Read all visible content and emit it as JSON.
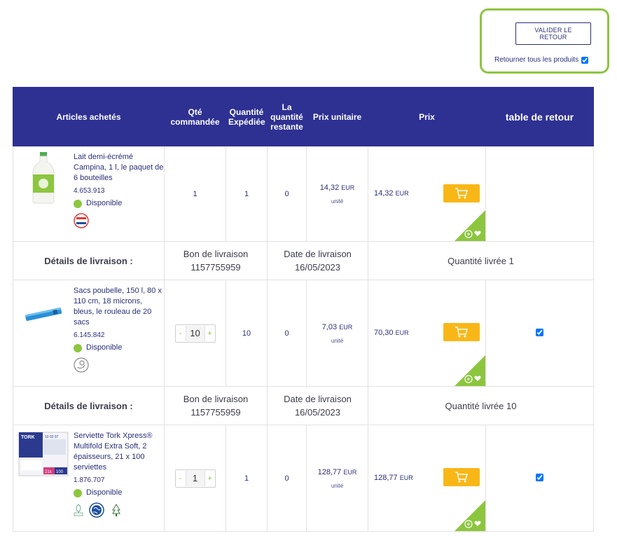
{
  "actions": {
    "validate_label": "VALIDER LE RETOUR",
    "return_all_label": "Retourner tous les produits",
    "return_all_checked": true
  },
  "table": {
    "headers": {
      "articles": "Articles achetés",
      "qty_ordered": "Qté commandée",
      "qty_shipped": "Quantité Expédiée",
      "qty_remaining": "La quantité restante",
      "unit_price": "Prix unitaire",
      "price": "Prix",
      "return_table": "table de retour"
    },
    "products": [
      {
        "name": "Lait demi-écrémé Campina, 1 l, le paquet de 6 bouteilles",
        "ref": "4.653.913",
        "availability": "Disponible",
        "qty_ordered": "1",
        "qty_shipped": "1",
        "qty_remaining": "0",
        "unit_price_main": "14,32",
        "unit_price_cur": "EUR",
        "unit_label": "unité",
        "price_main": "14,32",
        "price_cur": "EUR",
        "return_checked": false,
        "details": {
          "label": "Détails de livraison :",
          "delivery_note_label": "Bon de livraison",
          "delivery_note": "1157755959",
          "date_label": "Date de livraison",
          "date": "16/05/2023",
          "delivered_qty": "Quantité livrée 1"
        }
      },
      {
        "name": "Sacs poubelle, 150 l, 80 x 110 cm, 18 microns, bleus, le rouleau de 20 sacs",
        "ref": "6.145.842",
        "availability": "Disponible",
        "qty_ordered": "10",
        "qty_shipped": "10",
        "qty_remaining": "0",
        "unit_price_main": "7,03",
        "unit_price_cur": "EUR",
        "unit_label": "unité",
        "price_main": "70,30",
        "price_cur": "EUR",
        "return_checked": true,
        "details": {
          "label": "Détails de livraison :",
          "delivery_note_label": "Bon de livraison",
          "delivery_note": "1157755959",
          "date_label": "Date de livraison",
          "date": "16/05/2023",
          "delivered_qty": "Quantité livrée 10"
        }
      },
      {
        "name": "Serviette Tork Xpress® Multifold Extra Soft, 2 épaisseurs, 21 x 100 serviettes",
        "ref": "1.876.707",
        "availability": "Disponible",
        "qty_ordered": "1",
        "qty_shipped": "1",
        "qty_remaining": "0",
        "unit_price_main": "128,77",
        "unit_price_cur": "EUR",
        "unit_label": "unité",
        "price_main": "128,77",
        "price_cur": "EUR",
        "return_checked": true
      }
    ],
    "stepper": {
      "minus": "-",
      "plus": "+"
    },
    "tork_label": {
      "brand": "TORK",
      "code": "10 02 97",
      "pack": "21x",
      "count": "100"
    }
  },
  "colors": {
    "header_bg": "#2e3192",
    "accent_green": "#8cc63f",
    "cart_yellow": "#f9b717"
  },
  "icons": [
    "milk-bottle-image",
    "garbage-bag-image",
    "tork-pack-image",
    "netherlands-flag-icon",
    "hand-recycle-icon",
    "eco-label-icon",
    "globe-icon",
    "fsc-icon",
    "cart-icon",
    "favorite-heart-icon",
    "add-circle-icon"
  ]
}
